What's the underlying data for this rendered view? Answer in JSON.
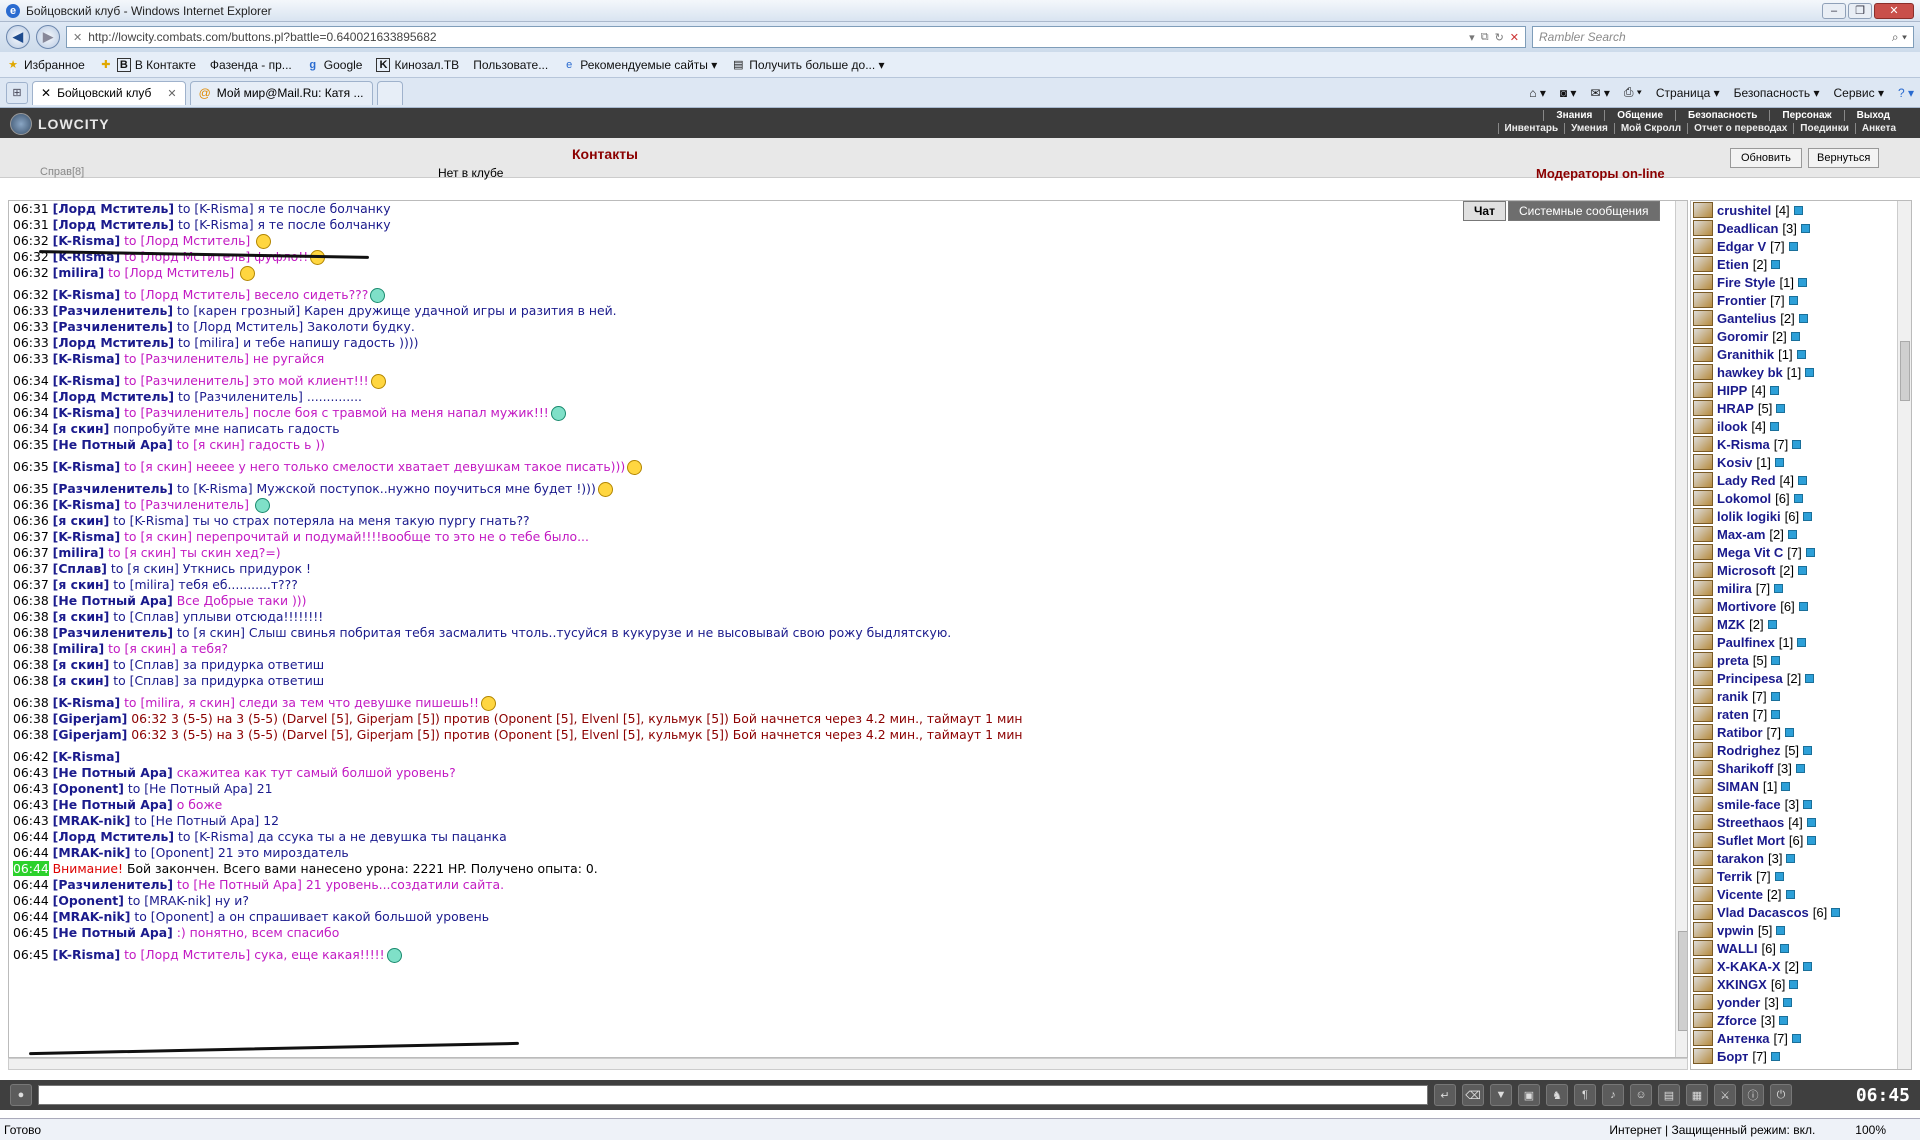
{
  "window": {
    "title": "Бойцовский клуб - Windows Internet Explorer"
  },
  "address": {
    "url": "http://lowcity.combats.com/buttons.pl?battle=0.640021633895682",
    "search_placeholder": "Rambler Search"
  },
  "favorites": {
    "label": "Избранное",
    "items": [
      "В Контакте",
      "Фазенда - пр...",
      "Google",
      "Кинозал.ТВ",
      "Пользовате...",
      "Рекомендуемые сайты ▾",
      "Получить больше до... ▾"
    ]
  },
  "tabs": [
    {
      "label": "Бойцовский клуб"
    },
    {
      "label": "Мой мир@Mail.Ru: Катя ..."
    }
  ],
  "commands": {
    "page": "Страница ▾",
    "safety": "Безопасность ▾",
    "service": "Сервис ▾"
  },
  "game": {
    "logo": "LOWCITY",
    "menu": [
      "Знания",
      "Общение",
      "Безопасность",
      "Персонаж",
      "Выход"
    ],
    "submenu": [
      "Инвентарь",
      "Умения",
      "Мой Скролл",
      "Отчет о переводах",
      "Поединки",
      "Анкета"
    ],
    "contacts_title": "Контакты",
    "refresh_btn": "Обновить",
    "back_btn": "Вернуться",
    "sprav": "Справ[8]",
    "not_in_club": "Нет в клубе",
    "moderators": "Модераторы on-line",
    "chat_tab": "Чат",
    "system_tab": "Системные сообщения"
  },
  "chat": [
    {
      "t": "06:31",
      "n": "Лорд Мститель",
      "to": "[K-Risma]",
      "m": "я те после болчанку",
      "c": "to"
    },
    {
      "t": "06:31",
      "n": "Лорд Мститель",
      "to": "[K-Risma]",
      "m": "я те после болчанку",
      "c": "to"
    },
    {
      "t": "06:32",
      "n": "K-Risma",
      "to": "[Лорд Мститель]",
      "m": "",
      "c": "pm",
      "s": 1
    },
    {
      "t": "06:32",
      "n": "K-Risma",
      "to": "[Лорд Мститель]",
      "m": "фуфло!!",
      "c": "pm",
      "s": 1
    },
    {
      "t": "06:32",
      "n": "milira",
      "to": "[Лорд Мститель]",
      "m": "",
      "c": "pm",
      "s": 1
    },
    {
      "t": "06:32",
      "n": "K-Risma",
      "to": "[Лорд Мститель]",
      "m": "   весело сидеть???",
      "c": "pm",
      "s": 2,
      "g": 1
    },
    {
      "t": "06:33",
      "n": "Разчиленитель",
      "to": "[карен грозный]",
      "m": "Карен дружище удачной игры и разития в ней.",
      "c": "to"
    },
    {
      "t": "06:33",
      "n": "Разчиленитель",
      "to": "[Лорд Мститель]",
      "m": "Заколоти будку.",
      "c": "to"
    },
    {
      "t": "06:33",
      "n": "Лорд Мститель",
      "to": "[milira]",
      "m": "и тебе напишу гадость ))))",
      "c": "to"
    },
    {
      "t": "06:33",
      "n": "K-Risma",
      "to": "[Разчиленитель]",
      "m": "не ругайся",
      "c": "pm"
    },
    {
      "t": "06:34",
      "n": "K-Risma",
      "to": "[Разчиленитель]",
      "m": "это мой клиент!!!",
      "c": "pm",
      "s": 1,
      "g": 1
    },
    {
      "t": "06:34",
      "n": "Лорд Мститель",
      "to": "[Разчиленитель]",
      "m": "..............",
      "c": "to"
    },
    {
      "t": "06:34",
      "n": "K-Risma",
      "to": "[Разчиленитель]",
      "m": "после боя с травмой на меня напал мужик!!!",
      "c": "pm",
      "s": 2
    },
    {
      "t": "06:34",
      "n": "я скин",
      "to": "",
      "m": "попробуйте мне написать гадость",
      "c": "to"
    },
    {
      "t": "06:35",
      "n": "Не Потный Ара",
      "to": "[я скин]",
      "m": "гадость ь ))",
      "c": "pm"
    },
    {
      "t": "06:35",
      "n": "K-Risma",
      "to": "[я скин]",
      "m": "нееее   у него только смелости хватает девушкам такое писать)))",
      "c": "pm",
      "s": 1,
      "g": 1
    },
    {
      "t": "06:35",
      "n": "Разчиленитель",
      "to": "[K-Risma]",
      "m": "Мужской поступок..нужно поучиться мне будет !)))",
      "c": "to",
      "s": 1,
      "g": 1
    },
    {
      "t": "06:36",
      "n": "K-Risma",
      "to": "[Разчиленитель]",
      "m": "",
      "c": "pm",
      "s": 2
    },
    {
      "t": "06:36",
      "n": "я скин",
      "to": "[K-Risma]",
      "m": "ты чо страх потеряла на меня такую пургу гнать??",
      "c": "to"
    },
    {
      "t": "06:37",
      "n": "K-Risma",
      "to": "[я скин]",
      "m": "перепрочитай и подумай!!!!вообще то это не о тебе было...",
      "c": "pm"
    },
    {
      "t": "06:37",
      "n": "milira",
      "to": "[я скин]",
      "m": "ты скин хед?=)",
      "c": "pm"
    },
    {
      "t": "06:37",
      "n": "Сплав",
      "to": "[я скин]",
      "m": "Уткнись придурок !",
      "c": "to"
    },
    {
      "t": "06:37",
      "n": "я скин",
      "to": "[milira]",
      "m": "тебя еб...........т???",
      "c": "to"
    },
    {
      "t": "06:38",
      "n": "Не Потный Ара",
      "to": "",
      "m": "Все Добрые таки )))",
      "c": "pm"
    },
    {
      "t": "06:38",
      "n": "я скин",
      "to": "[Сплав]",
      "m": "уплыви отсюда!!!!!!!!",
      "c": "to"
    },
    {
      "t": "06:38",
      "n": "Разчиленитель",
      "to": "[я скин]",
      "m": "Слыш свинья побритая тебя засмалить чтоль..тусуйся в кукурузе и не высовывай свою рожу быдлятскую.",
      "c": "to"
    },
    {
      "t": "06:38",
      "n": "milira",
      "to": "[я скин]",
      "m": "а тебя?",
      "c": "pm"
    },
    {
      "t": "06:38",
      "n": "я скин",
      "to": "[Сплав]",
      "m": "за придурка ответиш",
      "c": "to"
    },
    {
      "t": "06:38",
      "n": "я скин",
      "to": "[Сплав]",
      "m": "за придурка ответиш",
      "c": "to"
    },
    {
      "t": "06:38",
      "n": "K-Risma",
      "to": "[milira, я скин]",
      "m": "        следи за тем что девушке пишешь!!",
      "c": "pm",
      "s": 1,
      "g": 2
    },
    {
      "t": "06:38",
      "n": "Giperjam",
      "to": "",
      "m": "06:32 3 (5-5) на 3 (5-5) (Darvel [5], Giperjam [5]) против (Oponent [5], Elvenl [5], кульмук [5]) Бой начнется через 4.2 мин., таймаут 1 мин",
      "c": "sys"
    },
    {
      "t": "06:38",
      "n": "Giperjam",
      "to": "",
      "m": "06:32 3 (5-5) на 3 (5-5) (Darvel [5], Giperjam [5]) против (Oponent [5], Elvenl [5], кульмук [5]) Бой начнется через 4.2 мин., таймаут 1 мин",
      "c": "sys"
    },
    {
      "t": "06:42",
      "n": "K-Risma",
      "to": "",
      "m": "",
      "c": "pm",
      "g": 2
    },
    {
      "t": "06:43",
      "n": "Не Потный Ара",
      "to": "",
      "m": "скажитеа как тут самый болшой уровень?",
      "c": "pm"
    },
    {
      "t": "06:43",
      "n": "Oponent",
      "to": "[Не Потный Ара]",
      "m": "21",
      "c": "to"
    },
    {
      "t": "06:43",
      "n": "Не Потный Ара",
      "to": "",
      "m": "о боже",
      "c": "pm"
    },
    {
      "t": "06:43",
      "n": "MRAK-nik",
      "to": "[Не Потный Ара]",
      "m": "12",
      "c": "to"
    },
    {
      "t": "06:44",
      "n": "Лорд Мститель",
      "to": "[K-Risma]",
      "m": "да ссука ты а не девушка ты пацанка",
      "c": "to"
    },
    {
      "t": "06:44",
      "n": "MRAK-nik",
      "to": "[Oponent]",
      "m": "21 это мироздатель",
      "c": "to"
    },
    {
      "t": "06:44",
      "n": "",
      "to": "",
      "m": "Бой закончен. Всего вами нанесено урона: 2221 HP. Получено опыта: 0.",
      "c": "warn",
      "w": "Внимание!"
    },
    {
      "t": "06:44",
      "n": "Разчиленитель",
      "to": "[Не Потный Ара]",
      "m": "21 уровень...создатили сайта.",
      "c": "pm"
    },
    {
      "t": "06:44",
      "n": "Oponent",
      "to": "[MRAK-nik]",
      "m": "ну и?",
      "c": "to"
    },
    {
      "t": "06:44",
      "n": "MRAK-nik",
      "to": "[Oponent]",
      "m": "а он спрашивает какой большой уровень",
      "c": "to"
    },
    {
      "t": "06:45",
      "n": "Не Потный Ара",
      "to": "",
      "m": ":) понятно, всем спасибо",
      "c": "pm"
    },
    {
      "t": "06:45",
      "n": "K-Risma",
      "to": "[Лорд Мститель]",
      "m": "    сука, еще какая!!!!!",
      "c": "pm",
      "s": 2,
      "g": 1
    }
  ],
  "online": [
    [
      "crushitel",
      "4"
    ],
    [
      "Deadlican",
      "3"
    ],
    [
      "Edgar V",
      "7"
    ],
    [
      "Etien",
      "2"
    ],
    [
      "Fire Style",
      "1"
    ],
    [
      "Frontier",
      "7"
    ],
    [
      "Gantelius",
      "2"
    ],
    [
      "Goromir",
      "2"
    ],
    [
      "Granithik",
      "1"
    ],
    [
      "hawkey bk",
      "1"
    ],
    [
      "HIPP",
      "4"
    ],
    [
      "HRAP",
      "5"
    ],
    [
      "ilook",
      "4"
    ],
    [
      "K-Risma",
      "7"
    ],
    [
      "Kosiv",
      "1"
    ],
    [
      "Lady Red",
      "4"
    ],
    [
      "Lokomol",
      "6"
    ],
    [
      "lolik logiki",
      "6"
    ],
    [
      "Max-am",
      "2"
    ],
    [
      "Mega Vit C",
      "7"
    ],
    [
      "Microsoft",
      "2"
    ],
    [
      "milira",
      "7"
    ],
    [
      "Mortivore",
      "6"
    ],
    [
      "MZK",
      "2"
    ],
    [
      "Paulfinex",
      "1"
    ],
    [
      "preta",
      "5"
    ],
    [
      "Principesa",
      "2"
    ],
    [
      "ranik",
      "7"
    ],
    [
      "raten",
      "7"
    ],
    [
      "Ratibor",
      "7"
    ],
    [
      "Rodrighez",
      "5"
    ],
    [
      "Sharikoff",
      "3"
    ],
    [
      "SIMAN",
      "1"
    ],
    [
      "smile-face",
      "3"
    ],
    [
      "Streethaos",
      "4"
    ],
    [
      "Suflet Mort",
      "6"
    ],
    [
      "tarakon",
      "3"
    ],
    [
      "Terrik",
      "7"
    ],
    [
      "Vicente",
      "2"
    ],
    [
      "Vlad Dacascos",
      "6"
    ],
    [
      "vpwin",
      "5"
    ],
    [
      "WALLI",
      "6"
    ],
    [
      "X-KAKA-X",
      "2"
    ],
    [
      "XKINGX",
      "6"
    ],
    [
      "yonder",
      "3"
    ],
    [
      "Zforce",
      "3"
    ],
    [
      "Антенка",
      "7"
    ],
    [
      "Борт",
      "7"
    ]
  ],
  "clock": "06:45",
  "status": {
    "ready": "Готово",
    "zone": "Интернет | Защищенный режим: вкл.",
    "zoom": "100%"
  }
}
